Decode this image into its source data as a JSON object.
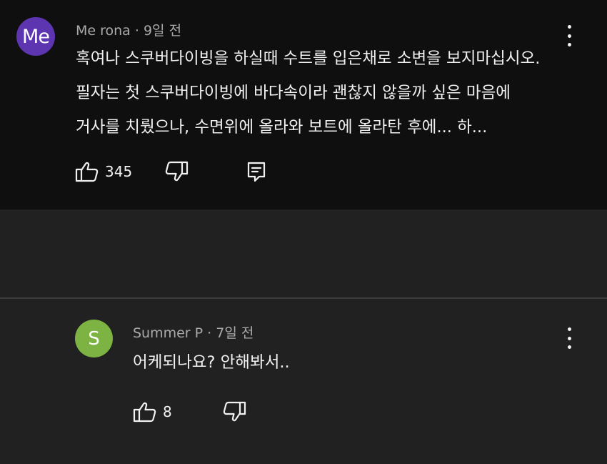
{
  "comments": [
    {
      "avatar_text": "Me",
      "avatar_color": "#5e35b1",
      "author": "Me rona",
      "time": "9일 전",
      "body_lines": [
        "혹여나 스쿠버다이빙을 하실때 수트를 입은채로 소변을 보지마십시오.",
        "필자는 첫 스쿠버다이빙에 바다속이라 괜찮지 않을까 싶은 마음에",
        "거사를 치뤘으나, 수면위에 올라와 보트에 올라탄 후에... 하..."
      ],
      "likes": "345"
    },
    {
      "avatar_text": "S",
      "avatar_color": "#7cb342",
      "author": "Summer P",
      "time": "7일 전",
      "body_lines": [
        "어케되나요? 안해봐서.."
      ],
      "likes": "8"
    }
  ],
  "meta_separator": "·",
  "icons": {
    "like": "thumbs-up-icon",
    "dislike": "thumbs-down-icon",
    "reply": "reply-icon",
    "menu": "more-vert-icon"
  },
  "colors": {
    "top_background": "#0f0f0f",
    "page_background": "#212121",
    "text": "#f1f1f1",
    "meta_text": "#aaaaaa"
  }
}
